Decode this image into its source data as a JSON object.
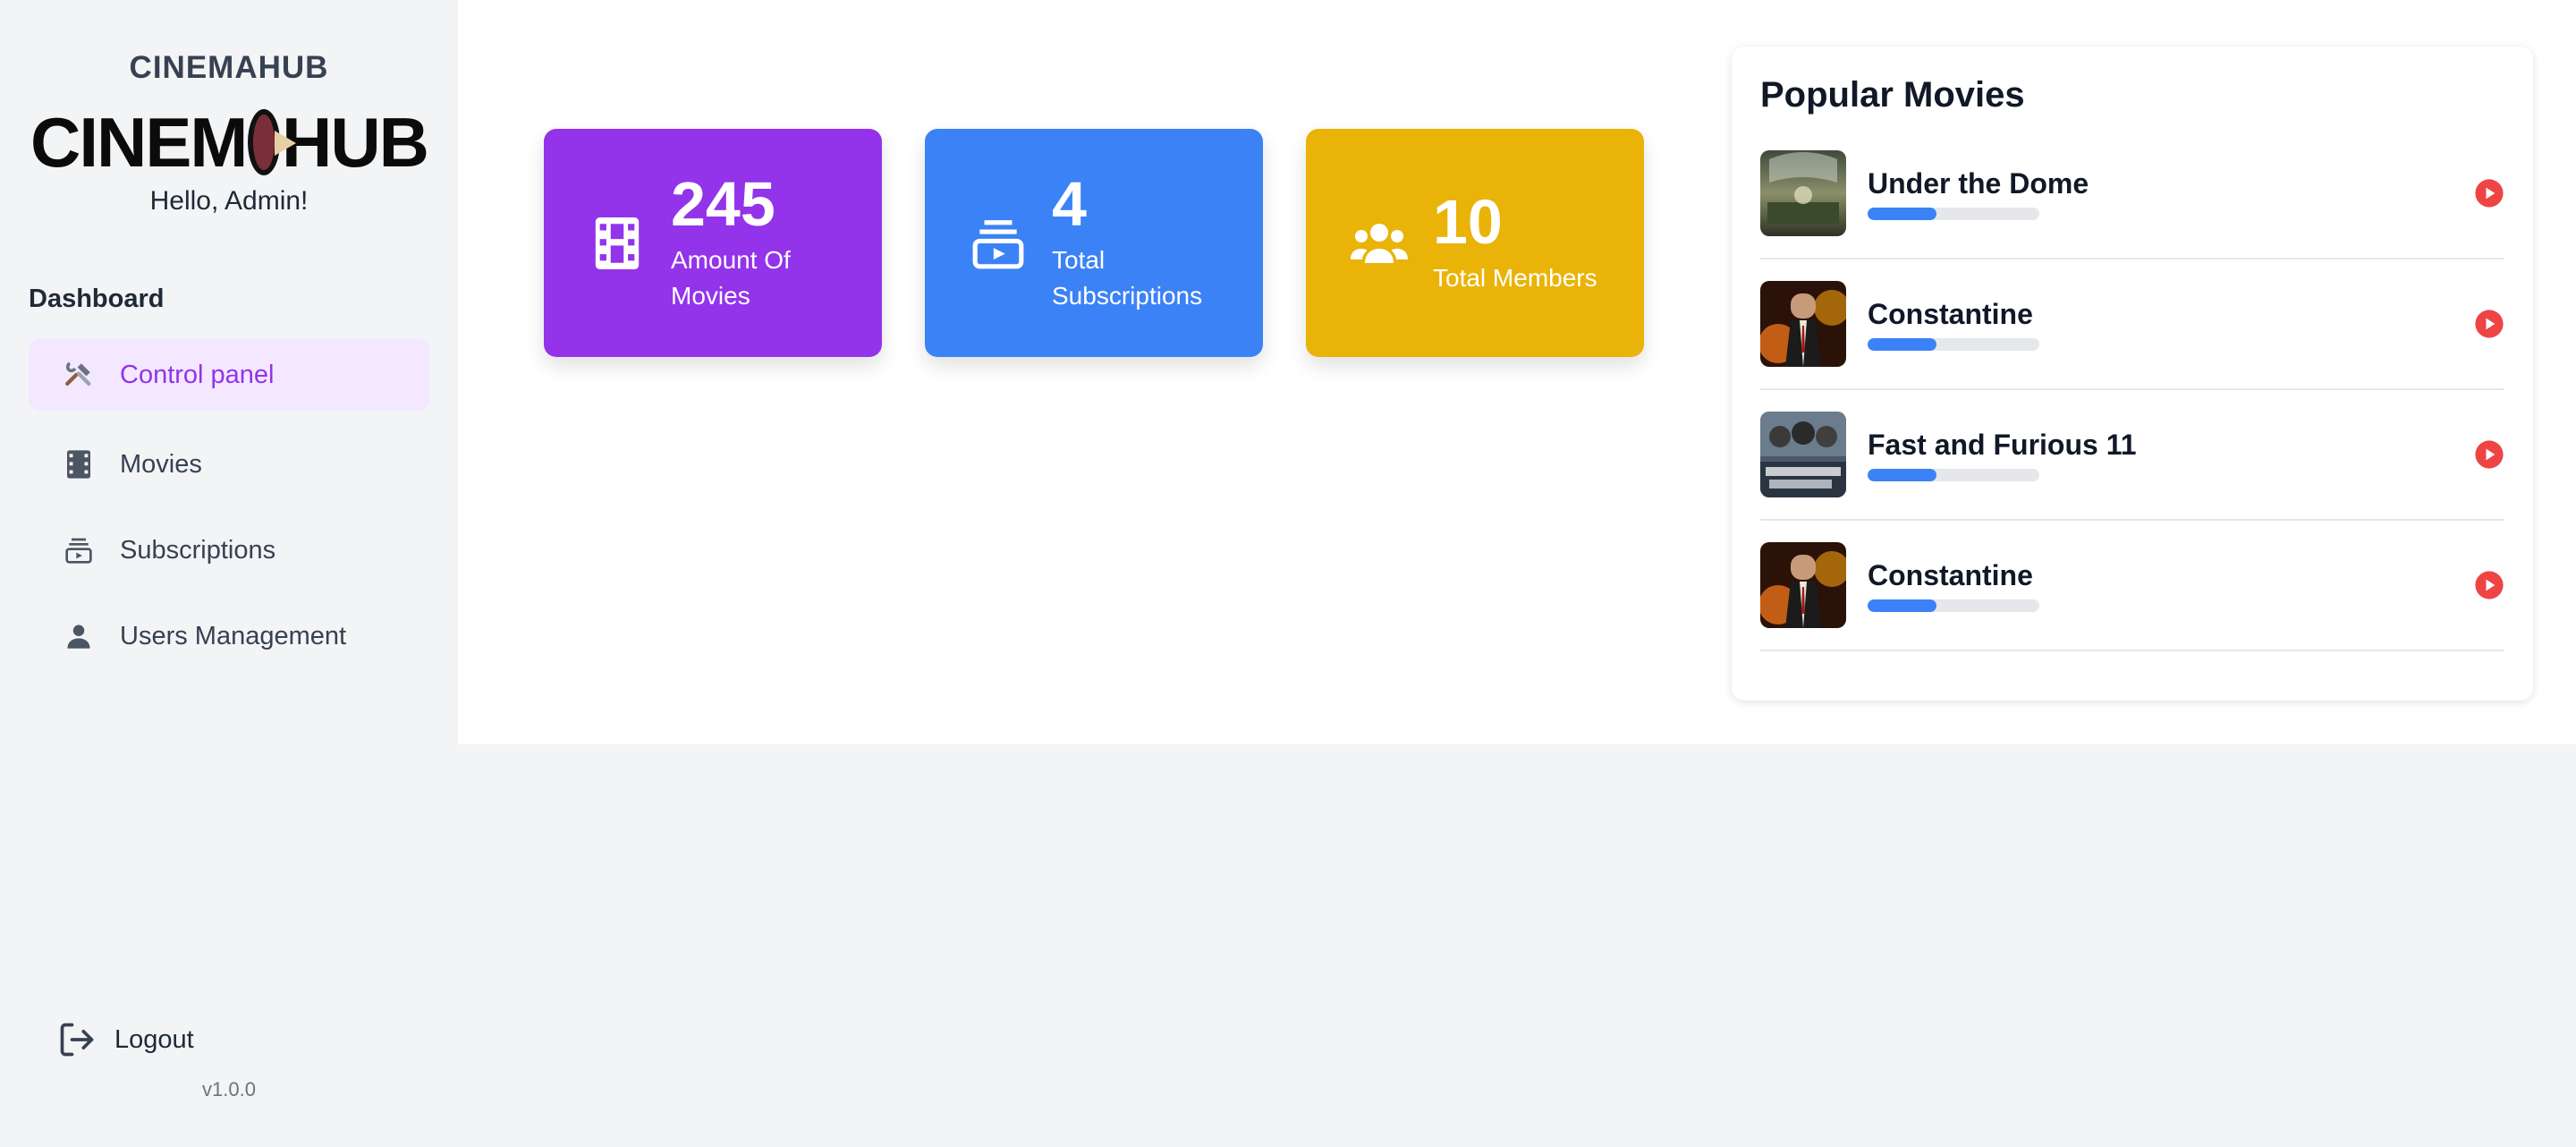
{
  "sidebar": {
    "brand_name": "CINEMAHUB",
    "logo_text_left": "CINEM",
    "logo_text_right": "HUB",
    "greeting": "Hello, Admin!",
    "section_title": "Dashboard",
    "items": [
      {
        "label": "Control panel",
        "icon": "tools-icon",
        "active": true
      },
      {
        "label": "Movies",
        "icon": "film-icon",
        "active": false
      },
      {
        "label": "Subscriptions",
        "icon": "subscriptions-icon",
        "active": false
      },
      {
        "label": "Users Management",
        "icon": "user-icon",
        "active": false
      }
    ],
    "logout_label": "Logout",
    "version": "v1.0.0"
  },
  "stats": [
    {
      "value": "245",
      "label": "Amount Of Movies",
      "icon": "film-icon",
      "color": "#9333ea"
    },
    {
      "value": "4",
      "label": "Total Subscriptions",
      "icon": "subscriptions-icon",
      "color": "#3b82f6"
    },
    {
      "value": "10",
      "label": "Total Members",
      "icon": "users-icon",
      "color": "#eab308"
    }
  ],
  "popular": {
    "title": "Popular Movies",
    "movies": [
      {
        "title": "Under the Dome",
        "progress": 0.4
      },
      {
        "title": "Constantine",
        "progress": 0.4
      },
      {
        "title": "Fast and Furious 11",
        "progress": 0.4
      },
      {
        "title": "Constantine",
        "progress": 0.4
      }
    ]
  },
  "colors": {
    "accent_purple": "#9333ea",
    "accent_blue": "#3b82f6",
    "accent_yellow": "#eab308",
    "play_red": "#ef4444"
  }
}
